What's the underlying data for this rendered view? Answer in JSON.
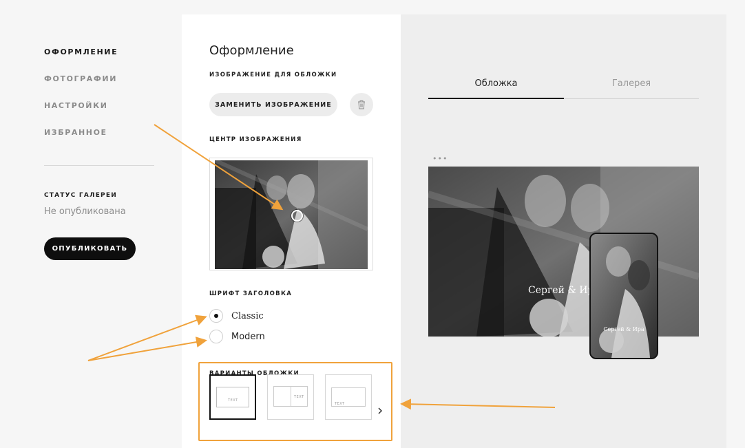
{
  "nav": {
    "items": [
      {
        "label": "ОФОРМЛЕНИЕ",
        "active": true
      },
      {
        "label": "ФОТОГРАФИИ",
        "active": false
      },
      {
        "label": "НАСТРОЙКИ",
        "active": false
      },
      {
        "label": "ИЗБРАННОЕ",
        "active": false
      }
    ],
    "status_label": "СТАТУС ГАЛЕРЕИ",
    "status_value": "Не опубликована",
    "publish_label": "ОПУБЛИКОВАТЬ"
  },
  "panel": {
    "title": "Оформление",
    "cover_image_label": "ИЗОБРАЖЕНИЕ ДЛЯ ОБЛОЖКИ",
    "replace_label": "ЗАМЕНИТЬ ИЗОБРАЖЕНИЕ",
    "trash_icon": "trash-icon",
    "center_label": "ЦЕНТР ИЗОБРАЖЕНИЯ",
    "font_label": "ШРИФТ ЗАГОЛОВКА",
    "fonts": [
      {
        "label": "Classic",
        "checked": true
      },
      {
        "label": "Modern",
        "checked": false
      }
    ],
    "variants_label": "ВАРИАНТЫ ОБЛОЖКИ",
    "variant_text": "TEXT",
    "next_icon": "chevron-right-icon"
  },
  "preview": {
    "tabs": [
      {
        "label": "Обложка",
        "active": true
      },
      {
        "label": "Галерея",
        "active": false
      }
    ],
    "dots": "•••",
    "desktop_title": "Сергей & Ир",
    "phone_title": "Сергей & Ира"
  },
  "colors": {
    "annotation": "#f0a23b",
    "publish_bg": "#0e0e0e",
    "panel_bg": "#ffffff",
    "preview_bg": "#eeeeee"
  }
}
